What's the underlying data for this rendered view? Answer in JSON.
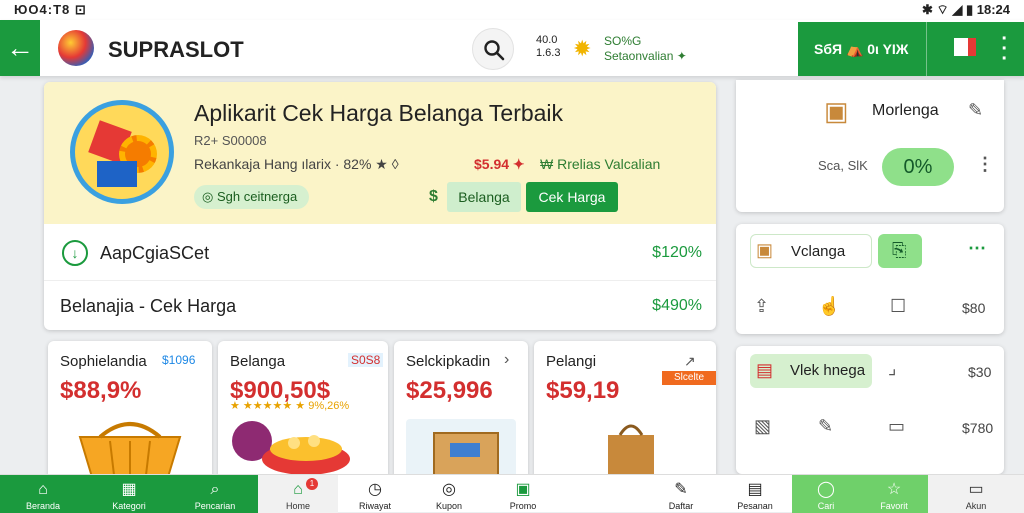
{
  "statusbar": {
    "left": "ЮО4:Т8 ⊡",
    "right": "✱ ⌔ ◢ ▮ 18:24"
  },
  "appbar": {
    "back": "←",
    "brand": "SUPRASLOT",
    "mini_stats_1": "40.0",
    "mini_stats_2": "1.6.3",
    "promo_1": "SO%G",
    "promo_2": "Setaonvalian ✦",
    "account": "ЅбЯ ⛺ 0ι ΥΙЖ"
  },
  "hero": {
    "title": "Aplikarit Cek Harga Belanga Terbaik",
    "code": "R2+ S00008",
    "rating": "Rekankaja Hang ılarix  ·  82% ★  ◊",
    "price": "$5.94 ✦",
    "green_note": "₩ Rrelias Valcalian",
    "subtag": "Sgh ceitnerga",
    "btn_light": "Belanga",
    "btn_dark": "Cek Harga",
    "row1_label": "AapCgiaSCet",
    "row1_pct": "$120%",
    "row2_label": "Belanajia  -  Cek Harga",
    "row2_pct": "$490%"
  },
  "products": [
    {
      "name": "Sophielandia",
      "tag": "$1096",
      "price": "$88,9%"
    },
    {
      "name": "Belanga",
      "tag": "S0S8",
      "price": "$900,50$",
      "stars": "★ ★★★★★ ★ 9%,26%"
    },
    {
      "name": "Selckipkadin",
      "tag": "›",
      "price": "$25,996"
    },
    {
      "name": "Pelangi",
      "tag": "↗",
      "price": "$59,19",
      "badge": "Slcelte"
    }
  ],
  "side": {
    "r1_label": "Morlenga",
    "r2_label": "Sca, SlK",
    "r2_pct": "0%",
    "s2_label": "Vclanga",
    "s2_val": "$80",
    "s3_label": "Vlek hnega",
    "s3_val1": "$30",
    "s3_val2": "$780"
  },
  "bottomnav": [
    {
      "label": "Beranda",
      "icon": "⌂"
    },
    {
      "label": "Kategori",
      "icon": "▦"
    },
    {
      "label": "Pencarian",
      "icon": "⌕"
    },
    {
      "label": "Home",
      "icon": "⌂",
      "badge": "1"
    },
    {
      "label": "Riwayat",
      "icon": "◷"
    },
    {
      "label": "Kupon",
      "icon": "◎"
    },
    {
      "label": "Promo",
      "icon": "▣"
    },
    {
      "label": "Daftar",
      "icon": "✎"
    },
    {
      "label": "Pesanan",
      "icon": "▤"
    },
    {
      "label": "Cari",
      "icon": "◯"
    },
    {
      "label": "Favorit",
      "icon": "☆"
    },
    {
      "label": "Akun",
      "icon": "▭"
    }
  ]
}
